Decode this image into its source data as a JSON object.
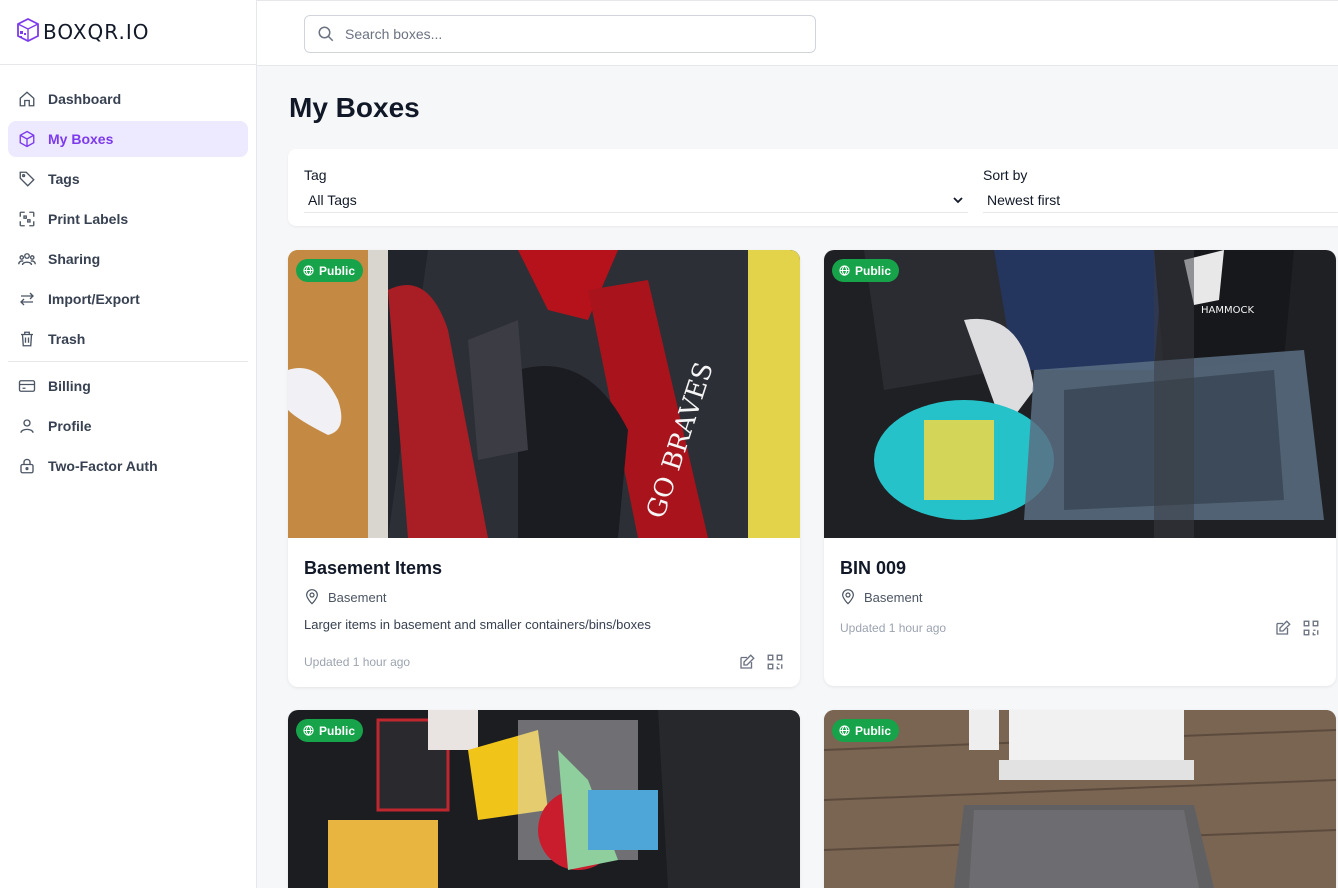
{
  "brand": {
    "name": "BOXQR.IO",
    "logo_icon": "box-qr-logo"
  },
  "search": {
    "placeholder": "Search boxes...",
    "value": ""
  },
  "sidebar": {
    "items": [
      {
        "label": "Dashboard",
        "icon": "home-icon"
      },
      {
        "label": "My Boxes",
        "icon": "cube-icon",
        "active": true
      },
      {
        "label": "Tags",
        "icon": "tag-icon"
      },
      {
        "label": "Print Labels",
        "icon": "qrcode-icon"
      },
      {
        "label": "Sharing",
        "icon": "users-icon"
      },
      {
        "label": "Import/Export",
        "icon": "arrows-icon"
      },
      {
        "label": "Trash",
        "icon": "trash-icon"
      },
      {
        "label": "Billing",
        "icon": "credit-card-icon"
      },
      {
        "label": "Profile",
        "icon": "user-icon"
      },
      {
        "label": "Two-Factor Auth",
        "icon": "lock-icon"
      }
    ]
  },
  "page": {
    "title": "My Boxes"
  },
  "filters": {
    "tag_label": "Tag",
    "tag_value": "All Tags",
    "sort_label": "Sort by",
    "sort_value": "Newest first"
  },
  "cards": [
    {
      "badge": "Public",
      "title": "Basement Items",
      "location": "Basement",
      "description": "Larger items in basement and smaller containers/bins/boxes",
      "updated": "Updated 1 hour ago",
      "image_text_1": "GO BRAVES"
    },
    {
      "badge": "Public",
      "title": "BIN 009",
      "location": "Basement",
      "description": "",
      "updated": "Updated 1 hour ago",
      "image_text_1": "HAMMOCK"
    },
    {
      "badge": "Public"
    },
    {
      "badge": "Public"
    }
  ],
  "colors": {
    "accent": "#7c3aed",
    "accent_bg": "#ede9fe",
    "badge_green": "#16a34a"
  }
}
